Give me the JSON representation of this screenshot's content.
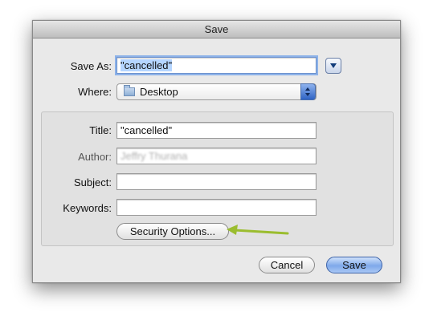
{
  "window": {
    "title": "Save"
  },
  "save_as": {
    "label": "Save As:",
    "value": "\"cancelled\""
  },
  "where": {
    "label": "Where:",
    "value": "Desktop"
  },
  "metadata": {
    "title_label": "Title:",
    "title_value": "\"cancelled\"",
    "author_label": "Author:",
    "author_value": "Jeffry Thurana",
    "subject_label": "Subject:",
    "subject_value": "",
    "keywords_label": "Keywords:",
    "keywords_value": ""
  },
  "security_button": {
    "label": "Security Options..."
  },
  "buttons": {
    "cancel": "Cancel",
    "save": "Save"
  },
  "colors": {
    "annotation_arrow": "#9bbd2f",
    "default_button": "#7fa9ea"
  },
  "icons": {
    "disclosure": "chevron-down-icon",
    "where_folder": "folder-icon",
    "where_stepper": "up-down-arrows-icon"
  }
}
